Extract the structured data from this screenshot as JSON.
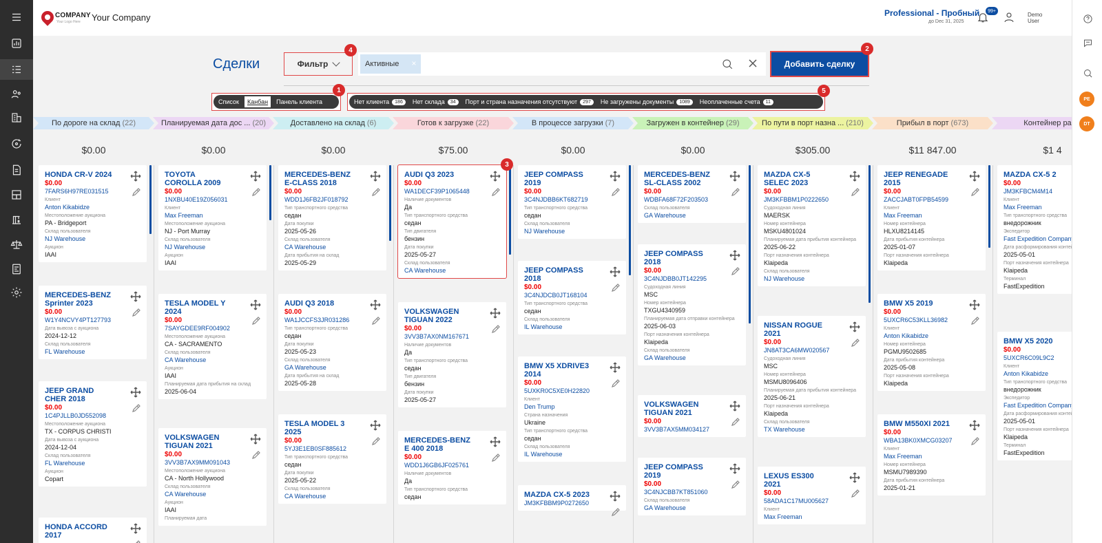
{
  "topbar": {
    "logo_text": "COMPANY",
    "logo_tagline": "Your Logo Here",
    "company_name": "Your Company",
    "plan": "Professional - Пробный",
    "plan_date": "до Dec 31, 2025",
    "notif_badge": "99+",
    "user_line1": "Demo",
    "user_line2": "User"
  },
  "sidebar": {
    "icons": [
      "menu-icon",
      "dashboard-icon",
      "deals-icon",
      "contacts-icon",
      "buildings-icon",
      "refresh-icon",
      "documents-icon",
      "warehouse-icon",
      "crane-icon",
      "scale-icon",
      "invoice-icon",
      "settings-icon"
    ]
  },
  "rightbar": {
    "icons": [
      "help-icon",
      "chat-icon",
      "search-icon"
    ],
    "avatars": [
      {
        "initials": "PE",
        "color": "#f07f1c"
      },
      {
        "initials": "DT",
        "color": "#f07f1c"
      }
    ]
  },
  "toolbar": {
    "title": "Сделки",
    "filter_label": "Фильтр",
    "search_chip": "Активные",
    "add_deal": "Добавить сделку",
    "markers": [
      "1",
      "2",
      "3",
      "4",
      "5"
    ]
  },
  "view_switch": [
    "Список",
    "Канбан",
    "Панель клиента"
  ],
  "quick_filters": [
    {
      "label": "Нет клиента",
      "count": "186"
    },
    {
      "label": "Нет склада",
      "count": "34"
    },
    {
      "label": "Порт и страна назначения отсутствуют",
      "count": "297"
    },
    {
      "label": "Не загружены документы",
      "count": "1089"
    },
    {
      "label": "Неоплаченные счета",
      "count": "11"
    }
  ],
  "stages": [
    {
      "name": "По дороге на склад",
      "count": "(22)",
      "color": "#d3e6f8"
    },
    {
      "name": "Планируемая дата дос ...",
      "count": "(20)",
      "color": "#ecd7f4"
    },
    {
      "name": "Доставлено на склад",
      "count": "(6)",
      "color": "#cdeef2"
    },
    {
      "name": "Готов к загрузке",
      "count": "(22)",
      "color": "#fad6db"
    },
    {
      "name": "В процессе загрузки",
      "count": "(7)",
      "color": "#d3e6f8"
    },
    {
      "name": "Загружен в контейнер",
      "count": "(29)",
      "color": "#c9f2b8"
    },
    {
      "name": "По пути в порт назна ...",
      "count": "(210)",
      "color": "#ecf3a0"
    },
    {
      "name": "Прибыл в порт",
      "count": "(673)",
      "color": "#fbe0c8"
    },
    {
      "name": "Контейнер расс",
      "count": "",
      "color": "#ecd7f4"
    }
  ],
  "columns": [
    {
      "total": "$0.00",
      "cards": [
        {
          "title": "HONDA CR-V 2024",
          "price": "$0.00",
          "vin": "7FARS6H97RE031515",
          "fields": [
            {
              "l": "Клиент",
              "v": "Anton Kikabidze",
              "link": true
            },
            {
              "l": "Местоположение аукциона",
              "v": "PA - Bridgeport"
            },
            {
              "l": "Склад пользователя",
              "v": "NJ Warehouse",
              "link": true
            },
            {
              "l": "Аукцион",
              "v": "IAAI"
            }
          ]
        },
        {
          "title": "MERCEDES-BENZ Sprinter 2023",
          "price": "$0.00",
          "vin": "W1Y4NCVY4PT127793",
          "fields": [
            {
              "l": "Дата вывоза с аукциона",
              "v": "2024-12-12"
            },
            {
              "l": "Склад пользователя",
              "v": "FL Warehouse",
              "link": true
            }
          ]
        },
        {
          "title": "JEEP GRAND CHER 2018",
          "price": "$0.00",
          "vin": "1C4PJLLB0JD552098",
          "fields": [
            {
              "l": "Местоположение аукциона",
              "v": "TX - CORPUS CHRISTI"
            },
            {
              "l": "Дата вывоза с аукциона",
              "v": "2024-12-04"
            },
            {
              "l": "Склад пользователя",
              "v": "FL Warehouse",
              "link": true
            },
            {
              "l": "Аукцион",
              "v": "Copart"
            }
          ]
        },
        {
          "title": "HONDA ACCORD 2017",
          "price": "",
          "vin": "",
          "fields": []
        }
      ]
    },
    {
      "total": "$0.00",
      "cards": [
        {
          "title": "TOYOTA COROLLA 2009",
          "price": "$0.00",
          "vin": "1NXBU40E19Z056031",
          "fields": [
            {
              "l": "Клиент",
              "v": "Max Freeman",
              "link": true
            },
            {
              "l": "Местоположение аукциона",
              "v": "NJ - Port Murray"
            },
            {
              "l": "Склад пользователя",
              "v": "NJ Warehouse",
              "link": true
            },
            {
              "l": "Аукцион",
              "v": "IAAI"
            }
          ]
        },
        {
          "title": "TESLA MODEL Y 2024",
          "price": "$0.00",
          "vin": "7SAYGDEE9RF004902",
          "fields": [
            {
              "l": "Местоположение аукциона",
              "v": "CA - SACRAMENTO"
            },
            {
              "l": "Склад пользователя",
              "v": "CA Warehouse",
              "link": true
            },
            {
              "l": "Аукцион",
              "v": "IAAI"
            },
            {
              "l": "Планируемая дата прибытия на склад",
              "v": "2025-06-04"
            }
          ]
        },
        {
          "title": "VOLKSWAGEN TIGUAN 2021",
          "price": "$0.00",
          "vin": "3VV3B7AX9MM091043",
          "fields": [
            {
              "l": "Местоположение аукциона",
              "v": "CA - North Hollywood"
            },
            {
              "l": "Склад пользователя",
              "v": "CA Warehouse",
              "link": true
            },
            {
              "l": "Аукцион",
              "v": "IAAI"
            },
            {
              "l": "Планируемая дата",
              "v": ""
            }
          ]
        }
      ]
    },
    {
      "total": "$0.00",
      "cards": [
        {
          "title": "MERCEDES-BENZ E-CLASS 2018",
          "price": "$0.00",
          "vin": "WDD1J6FB2JF018792",
          "fields": [
            {
              "l": "Тип транспортного средства",
              "v": "седан"
            },
            {
              "l": "Дата покупки",
              "v": "2025-05-26"
            },
            {
              "l": "Склад пользователя",
              "v": "CA Warehouse",
              "link": true
            },
            {
              "l": "Дата прибытия на склад",
              "v": "2025-05-29"
            }
          ]
        },
        {
          "title": "AUDI Q3 2018",
          "price": "$0.00",
          "vin": "WA1JCCFS3JR031286",
          "fields": [
            {
              "l": "Тип транспортного средства",
              "v": "седан"
            },
            {
              "l": "Дата покупки",
              "v": "2025-05-23"
            },
            {
              "l": "Склад пользователя",
              "v": "GA Warehouse",
              "link": true
            },
            {
              "l": "Дата прибытия на склад",
              "v": "2025-05-28"
            }
          ]
        },
        {
          "title": "TESLA MODEL 3 2025",
          "price": "$0.00",
          "vin": "5YJ3E1EB0SF885612",
          "fields": [
            {
              "l": "Тип транспортного средства",
              "v": "седан"
            },
            {
              "l": "Дата покупки",
              "v": "2025-05-22"
            },
            {
              "l": "Склад пользователя",
              "v": "CA Warehouse",
              "link": true
            }
          ]
        }
      ]
    },
    {
      "total": "$75.00",
      "cards": [
        {
          "title": "AUDI Q3 2023",
          "price": "$0.00",
          "vin": "WA1DECF39P1065448",
          "fields": [
            {
              "l": "Наличие документов",
              "v": "Да"
            },
            {
              "l": "Тип транспортного средства",
              "v": "седан"
            },
            {
              "l": "Тип двигателя",
              "v": "бензин"
            },
            {
              "l": "Дата покупки",
              "v": "2025-05-27"
            },
            {
              "l": "Склад пользователя",
              "v": "CA Warehouse",
              "link": true
            }
          ]
        },
        {
          "title": "VOLKSWAGEN TIGUAN 2022",
          "price": "$0.00",
          "vin": "3VV3B7AX0NM167671",
          "fields": [
            {
              "l": "Наличие документов",
              "v": "Да"
            },
            {
              "l": "Тип транспортного средства",
              "v": "седан"
            },
            {
              "l": "Тип двигателя",
              "v": "бензин"
            },
            {
              "l": "Дата покупки",
              "v": "2025-05-27"
            }
          ]
        },
        {
          "title": "MERCEDES-BENZ E 400 2018",
          "price": "$0.00",
          "vin": "WDD1J6GB6JF025761",
          "fields": [
            {
              "l": "Наличие документов",
              "v": "Да"
            },
            {
              "l": "Тип транспортного средства",
              "v": "седан"
            }
          ]
        }
      ]
    },
    {
      "total": "$0.00",
      "cards": [
        {
          "title": "JEEP COMPASS 2019",
          "price": "$0.00",
          "vin": "3C4NJDBB6KT682719",
          "fields": [
            {
              "l": "Тип транспортного средства",
              "v": "седан"
            },
            {
              "l": "Склад пользователя",
              "v": "NJ Warehouse",
              "link": true
            }
          ]
        },
        {
          "title": "JEEP COMPASS 2018",
          "price": "$0.00",
          "vin": "3C4NJDCB0JT168104",
          "fields": [
            {
              "l": "Тип транспортного средства",
              "v": "седан"
            },
            {
              "l": "Склад пользователя",
              "v": "IL Warehouse",
              "link": true
            }
          ]
        },
        {
          "title": "BMW X5 XDRIVE3 2014",
          "price": "$0.00",
          "vin": "5UXKR0C5XE0H22820",
          "fields": [
            {
              "l": "Клиент",
              "v": "Den Trump",
              "link": true
            },
            {
              "l": "Страна назначения",
              "v": "Ukraine"
            },
            {
              "l": "Тип транспортного средства",
              "v": "седан"
            },
            {
              "l": "Склад пользователя",
              "v": "IL Warehouse",
              "link": true
            }
          ]
        },
        {
          "title": "MAZDA CX-5 2023",
          "price": "",
          "vin": "JM3KFBBM9P0272650",
          "fields": []
        }
      ]
    },
    {
      "total": "$0.00",
      "cards": [
        {
          "title": "MERCEDES-BENZ SL-CLASS 2002",
          "price": "$0.00",
          "vin": "WDBFA68F72F203503",
          "fields": [
            {
              "l": "Склад пользователя",
              "v": "GA Warehouse",
              "link": true
            }
          ]
        },
        {
          "title": "JEEP COMPASS 2018",
          "price": "$0.00",
          "vin": "3C4NJDBB0JT142295",
          "fields": [
            {
              "l": "Судоходная линия",
              "v": "MSC"
            },
            {
              "l": "Номер контейнера",
              "v": "TXGU4340959"
            },
            {
              "l": "Планируемая дата отправки контейнера",
              "v": "2025-06-03"
            },
            {
              "l": "Порт назначения контейнера",
              "v": "Klaipeda"
            },
            {
              "l": "Склад пользователя",
              "v": "GA Warehouse",
              "link": true
            }
          ]
        },
        {
          "title": "VOLKSWAGEN TIGUAN 2021",
          "price": "$0.00",
          "vin": "3VV3B7AX5MM034127",
          "fields": []
        },
        {
          "title": "JEEP COMPASS 2019",
          "price": "$0.00",
          "vin": "3C4NJCBB7KT851060",
          "fields": [
            {
              "l": "Склад пользователя",
              "v": "GA Warehouse",
              "link": true
            }
          ]
        }
      ]
    },
    {
      "total": "$305.00",
      "cards": [
        {
          "title": "MAZDA CX-5 SELEC 2023",
          "price": "$0.00",
          "vin": "JM3KFBBM1P0222650",
          "fields": [
            {
              "l": "Судоходная линия",
              "v": "MAERSK"
            },
            {
              "l": "Номер контейнера",
              "v": "MSKU4801024"
            },
            {
              "l": "Планируемая дата прибытия контейнера",
              "v": "2025-06-22"
            },
            {
              "l": "Порт назначения контейнера",
              "v": "Klaipeda"
            },
            {
              "l": "Склад пользователя",
              "v": "NJ Warehouse",
              "link": true
            }
          ]
        },
        {
          "title": "NISSAN ROGUE 2021",
          "price": "$0.00",
          "vin": "JN8AT3CA6MW020567",
          "fields": [
            {
              "l": "Судоходная линия",
              "v": "MSC"
            },
            {
              "l": "Номер контейнера",
              "v": "MSMU8096406"
            },
            {
              "l": "Планируемая дата прибытия контейнера",
              "v": "2025-06-21"
            },
            {
              "l": "Порт назначения контейнера",
              "v": "Klaipeda"
            },
            {
              "l": "Склад пользователя",
              "v": "TX Warehouse",
              "link": true
            }
          ]
        },
        {
          "title": "LEXUS ES300 2021",
          "price": "$0.00",
          "vin": "58ADA1C17MU005627",
          "fields": [
            {
              "l": "Клиент",
              "v": "Max Freeman",
              "link": true
            }
          ]
        }
      ]
    },
    {
      "total": "$11 847.00",
      "cards": [
        {
          "title": "JEEP RENEGADE 2015",
          "price": "$0.00",
          "vin": "ZACCJABT0FPB54599",
          "fields": [
            {
              "l": "Клиент",
              "v": "Max Freeman",
              "link": true
            },
            {
              "l": "Номер контейнера",
              "v": "HLXU8214145"
            },
            {
              "l": "Дата прибытия контейнера",
              "v": "2025-01-07"
            },
            {
              "l": "Порт назначения контейнера",
              "v": "Klaipeda"
            }
          ]
        },
        {
          "title": "BMW X5 2019",
          "price": "$0.00",
          "vin": "5UXCR6C53KLL36982",
          "fields": [
            {
              "l": "Клиент",
              "v": "Anton Kikabidze",
              "link": true
            },
            {
              "l": "Номер контейнера",
              "v": "PGMU9502685"
            },
            {
              "l": "Дата прибытия контейнера",
              "v": "2025-05-08"
            },
            {
              "l": "Порт назначения контейнера",
              "v": "Klaipeda"
            }
          ]
        },
        {
          "title": "BMW M550XI 2021",
          "price": "$0.00",
          "vin": "WBA13BK0XMCG03207",
          "fields": [
            {
              "l": "Клиент",
              "v": "Max Freeman",
              "link": true
            },
            {
              "l": "Номер контейнера",
              "v": "MSMU7989390"
            },
            {
              "l": "Дата прибытия контейнера",
              "v": "2025-01-21"
            }
          ]
        }
      ]
    },
    {
      "total": "$1 4",
      "cards": [
        {
          "title": "MAZDA CX-5 2",
          "price": "$0.00",
          "vin": "JM3KFBCM4M14",
          "fields": [
            {
              "l": "Клиент",
              "v": "Max Freeman",
              "link": true
            },
            {
              "l": "Тип транспортного средства",
              "v": "внедорожник"
            },
            {
              "l": "Экспедитор",
              "v": "Fast Expedition Company",
              "link": true
            },
            {
              "l": "Дата расформирования контейнера",
              "v": "2025-05-01"
            },
            {
              "l": "Порт назначения контейнера",
              "v": "Klaipeda"
            },
            {
              "l": "Терминал",
              "v": "FastExpedition"
            }
          ]
        },
        {
          "title": "BMW X5 2020",
          "price": "$0.00",
          "vin": "5UXCR6C09L9C2",
          "fields": [
            {
              "l": "Клиент",
              "v": "Anton Kikabidze",
              "link": true
            },
            {
              "l": "Тип транспортного средства",
              "v": "внедорожник"
            },
            {
              "l": "Экспедитор",
              "v": "Fast Expedition Company",
              "link": true
            },
            {
              "l": "Дата расформирования контейнера",
              "v": "2025-05-01"
            },
            {
              "l": "Порт назначения контейнера",
              "v": "Klaipeda"
            },
            {
              "l": "Терминал",
              "v": "FastExpedition"
            }
          ]
        }
      ]
    }
  ]
}
